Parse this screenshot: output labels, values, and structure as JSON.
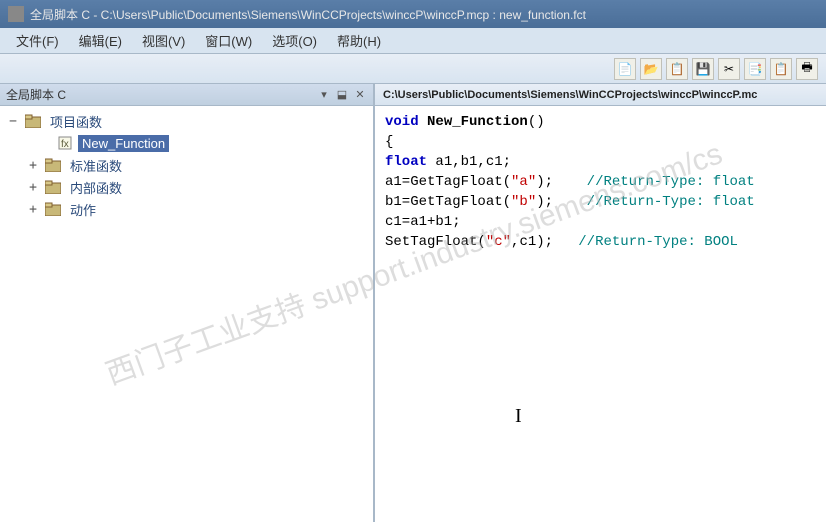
{
  "title": "全局脚本 C - C:\\Users\\Public\\Documents\\Siemens\\WinCCProjects\\winccP\\winccP.mcp : new_function.fct",
  "menubar": {
    "file": "文件(F)",
    "edit": "编辑(E)",
    "view": "视图(V)",
    "window": "窗口(W)",
    "options": "选项(O)",
    "help": "帮助(H)"
  },
  "sidebar": {
    "title": "全局脚本 C",
    "items": [
      {
        "label": "项目函数",
        "expander": "−"
      },
      {
        "label": "New_Function",
        "expander": ""
      },
      {
        "label": "标准函数",
        "expander": "+"
      },
      {
        "label": "内部函数",
        "expander": "+"
      },
      {
        "label": "动作",
        "expander": "+"
      }
    ]
  },
  "editor": {
    "path": "C:\\Users\\Public\\Documents\\Siemens\\WinCCProjects\\winccP\\winccP.mc",
    "code": {
      "kw_void": "void",
      "func_name": "New_Function",
      "parens": "()",
      "brace_open": "{",
      "kw_float": "float",
      "decl": " a1,b1,c1;",
      "l_a1": "a1=GetTagFloat(",
      "str_a": "\"a\"",
      "close_a": ");",
      "cmt_a": "//Return-Type: float",
      "l_b1": "b1=GetTagFloat(",
      "str_b": "\"b\"",
      "close_b": ");",
      "cmt_b": "//Return-Type: float",
      "l_c1": "c1=a1+b1;",
      "l_set": "SetTagFloat(",
      "str_c": "\"c\"",
      "close_c": ",c1);",
      "cmt_c": "//Return-Type: BOOL"
    }
  },
  "watermark": "西门子工业支持 support.industry.siemens.com/cs"
}
